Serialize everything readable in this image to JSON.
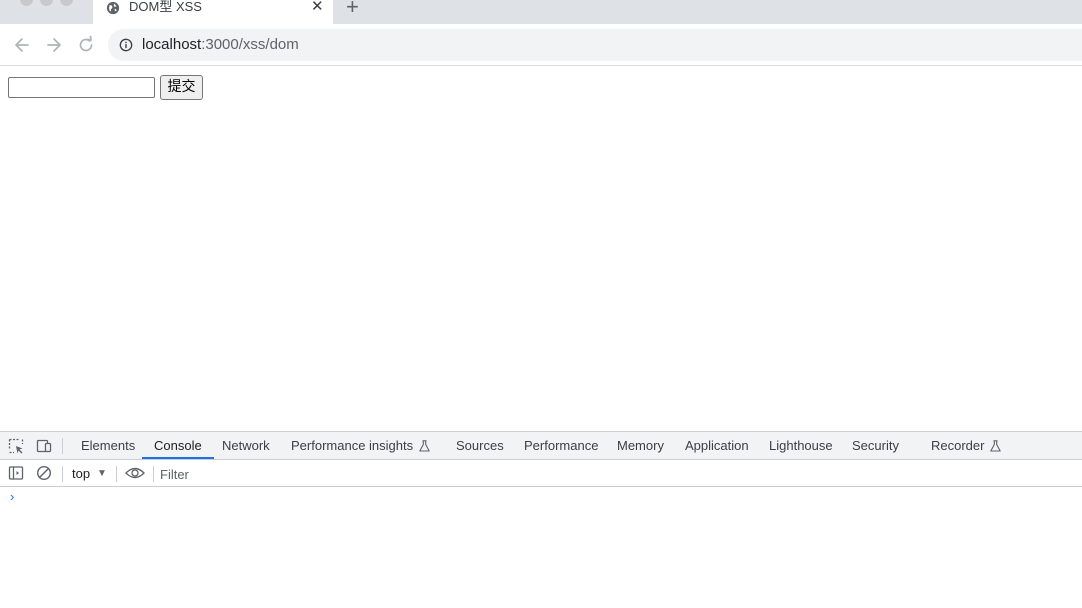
{
  "browser": {
    "tab": {
      "title": "DOM型 XSS",
      "close_glyph": "✕",
      "favicon": "globe-icon"
    },
    "new_tab_glyph": "+",
    "url": {
      "host": "localhost",
      "path": ":3000/xss/dom"
    }
  },
  "page": {
    "input": {
      "value": "",
      "placeholder": ""
    },
    "submit_label": "提交"
  },
  "devtools": {
    "tabs": [
      {
        "label": "Elements"
      },
      {
        "label": "Console",
        "active": true
      },
      {
        "label": "Network"
      },
      {
        "label": "Performance insights",
        "experimental": true
      },
      {
        "label": "Sources"
      },
      {
        "label": "Performance"
      },
      {
        "label": "Memory"
      },
      {
        "label": "Application"
      },
      {
        "label": "Lighthouse"
      },
      {
        "label": "Security"
      },
      {
        "label": "Recorder",
        "experimental": true
      }
    ],
    "console": {
      "context": "top",
      "filter_placeholder": "Filter",
      "prompt_glyph": "›"
    },
    "colors": {
      "accent": "#1a73e8",
      "toolbar_bg": "#f1f3f4"
    }
  }
}
